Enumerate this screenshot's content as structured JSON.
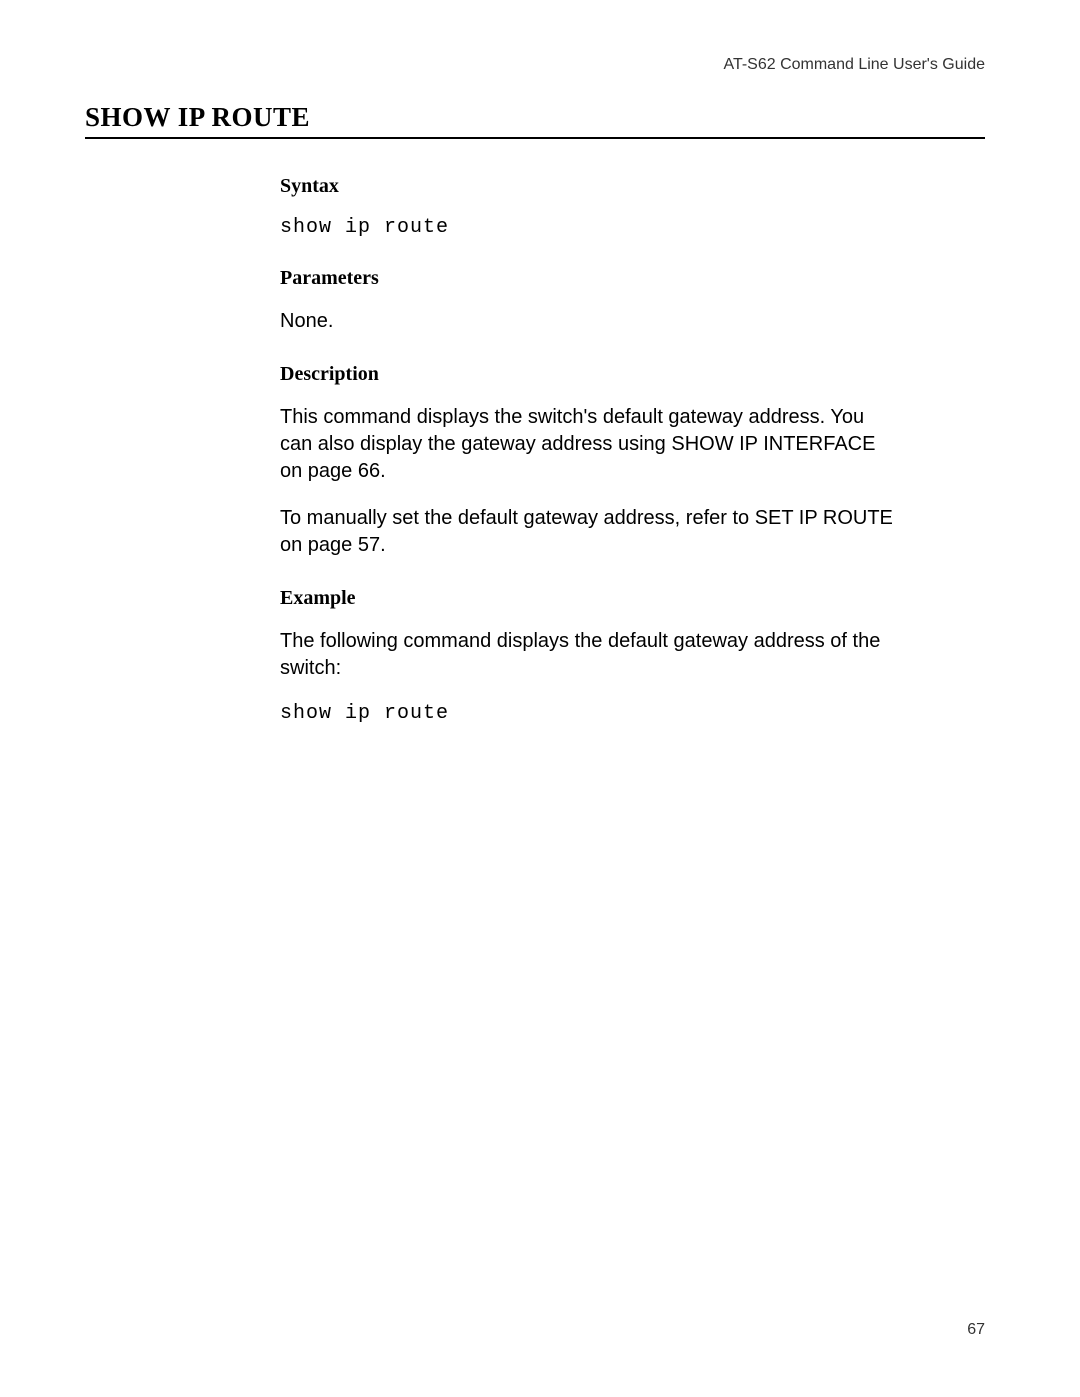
{
  "header": {
    "guide_title": "AT-S62 Command Line User's Guide"
  },
  "title": "SHOW IP ROUTE",
  "sections": {
    "syntax": {
      "heading": "Syntax",
      "command": "show ip route"
    },
    "parameters": {
      "heading": "Parameters",
      "text": "None."
    },
    "description": {
      "heading": "Description",
      "para1": "This command displays the switch's default gateway address. You can also display the gateway address using SHOW IP INTERFACE on page 66.",
      "para2": "To manually set the default gateway address, refer to SET IP ROUTE on page 57."
    },
    "example": {
      "heading": "Example",
      "intro": "The following command displays the default gateway address of the switch:",
      "command": "show ip route"
    }
  },
  "page_number": "67"
}
